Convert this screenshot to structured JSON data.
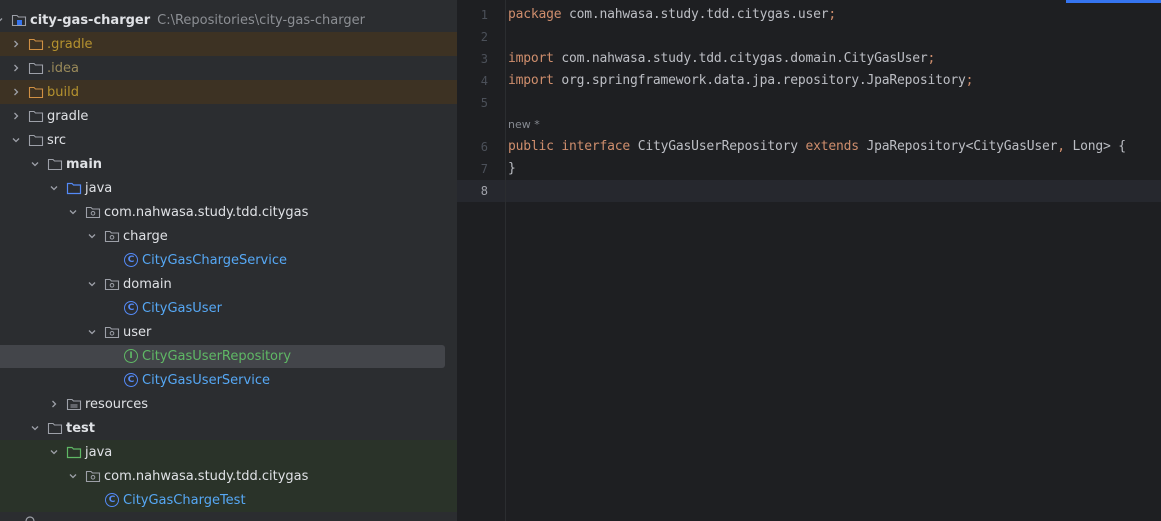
{
  "project": {
    "name": "city-gas-charger",
    "path": "C:\\Repositories\\city-gas-charger"
  },
  "tree": {
    "gradle_hidden": ".gradle",
    "idea": ".idea",
    "build": "build",
    "gradle": "gradle",
    "src": "src",
    "main": "main",
    "java": "java",
    "pkg": "com.nahwasa.study.tdd.citygas",
    "charge": "charge",
    "charge_service": "CityGasChargeService",
    "domain": "domain",
    "city_gas_user": "CityGasUser",
    "user": "user",
    "user_repository": "CityGasUserRepository",
    "user_service": "CityGasUserService",
    "resources": "resources",
    "test": "test",
    "test_java": "java",
    "test_pkg": "com.nahwasa.study.tdd.citygas",
    "charge_test": "CityGasChargeTest"
  },
  "editor": {
    "line_numbers": [
      "1",
      "2",
      "3",
      "4",
      "5",
      "6",
      "7",
      "8"
    ],
    "hint_text": "new *",
    "line1_kw": "package",
    "line1_rest": " com.nahwasa.study.tdd.citygas.user",
    "line3_kw": "import",
    "line3_rest": " com.nahwasa.study.tdd.citygas.domain.CityGasUser",
    "line4_kw": "import",
    "line4_rest": " org.springframework.data.jpa.repository.JpaRepository",
    "semicolon": ";",
    "line6_kw1": "public",
    "line6_kw2": "interface",
    "line6_name": "CityGasUserRepository",
    "line6_kw3": "extends",
    "line6_type": "JpaRepository<CityGasUser",
    "comma": ",",
    "line6_tail": " Long> {",
    "line7": "}"
  },
  "colors": {
    "keyword": "#cf8e6d",
    "class_icon": "#548af7",
    "interface_icon": "#5fb865"
  }
}
